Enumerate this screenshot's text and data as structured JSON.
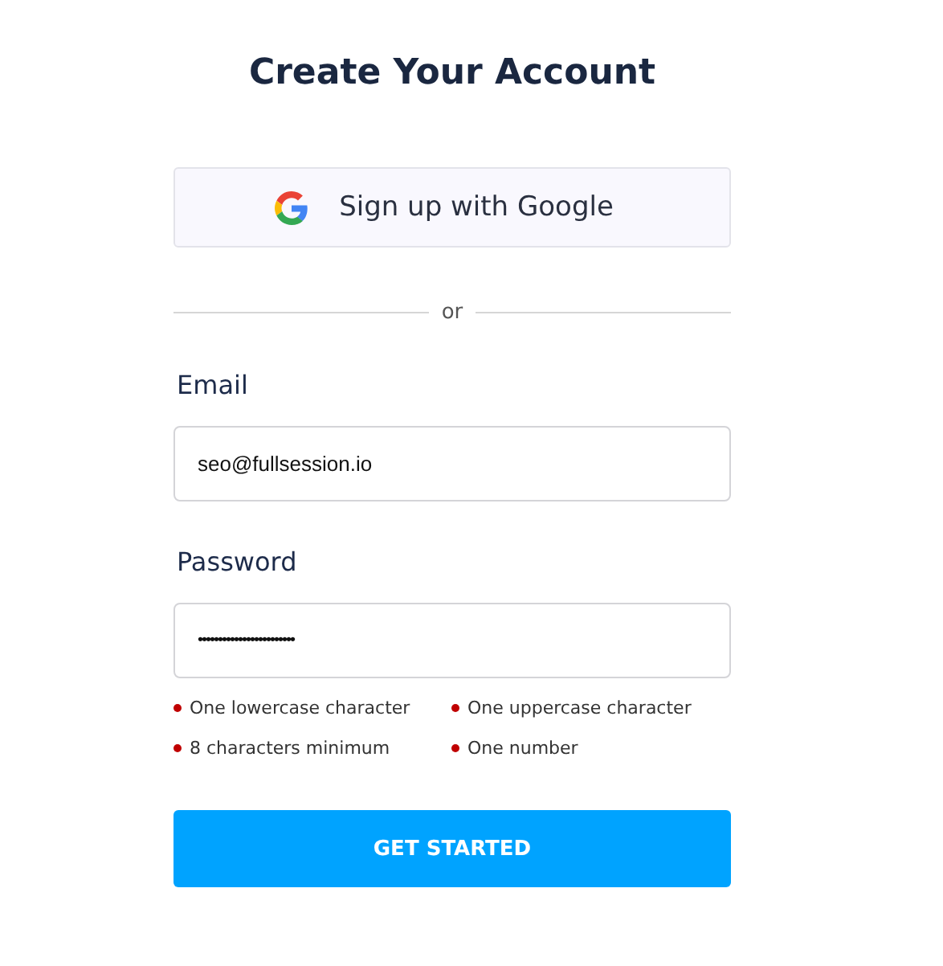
{
  "title": "Create Your Account",
  "google_button": {
    "label": "Sign up with Google"
  },
  "divider": {
    "label": "or"
  },
  "fields": [
    {
      "label": "Email",
      "value": "seo@fullsession.io"
    },
    {
      "label": "Password",
      "value": "••••••••••••••••••••••••"
    }
  ],
  "requirements": [
    {
      "text": "One lowercase character",
      "met": false
    },
    {
      "text": "One uppercase character",
      "met": false
    },
    {
      "text": "8 characters minimum",
      "met": false
    },
    {
      "text": "One number",
      "met": false
    }
  ],
  "submit_button": {
    "label": "GET STARTED"
  }
}
